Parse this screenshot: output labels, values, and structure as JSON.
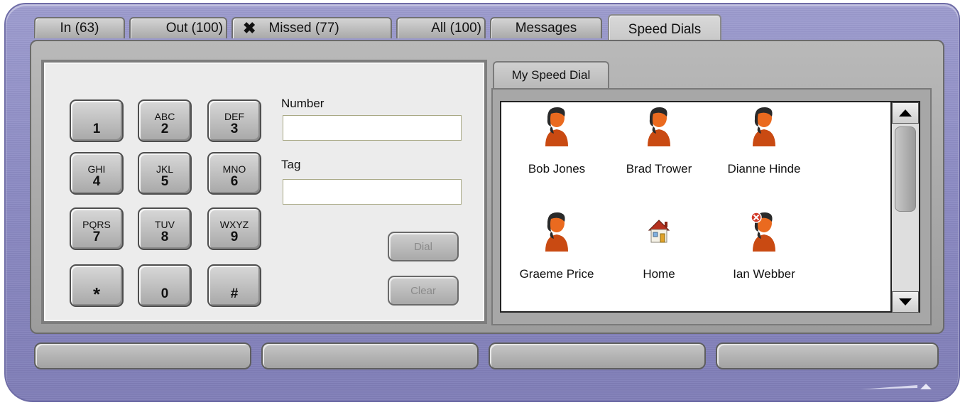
{
  "tabs": [
    {
      "label": "In (63)",
      "active": false
    },
    {
      "label": "Out (100)",
      "active": false
    },
    {
      "label": "Missed (77)",
      "active": false,
      "icon": "x-icon"
    },
    {
      "label": "All (100)",
      "active": false
    },
    {
      "label": "Messages",
      "active": false
    },
    {
      "label": "Speed Dials",
      "active": true
    }
  ],
  "keypad": [
    {
      "sub": "",
      "main": "1"
    },
    {
      "sub": "ABC",
      "main": "2"
    },
    {
      "sub": "DEF",
      "main": "3"
    },
    {
      "sub": "GHI",
      "main": "4"
    },
    {
      "sub": "JKL",
      "main": "5"
    },
    {
      "sub": "MNO",
      "main": "6"
    },
    {
      "sub": "PQRS",
      "main": "7"
    },
    {
      "sub": "TUV",
      "main": "8"
    },
    {
      "sub": "WXYZ",
      "main": "9"
    },
    {
      "sub": "",
      "main": "*"
    },
    {
      "sub": "",
      "main": "0"
    },
    {
      "sub": "",
      "main": "#"
    }
  ],
  "form": {
    "number_label": "Number",
    "number_value": "",
    "tag_label": "Tag",
    "tag_value": "",
    "dial_label": "Dial",
    "clear_label": "Clear"
  },
  "speed_dial": {
    "tab_label": "My Speed Dial",
    "contacts": [
      {
        "name": "Bob Jones",
        "icon": "person-icon"
      },
      {
        "name": "Brad Trower",
        "icon": "person-icon"
      },
      {
        "name": "Dianne Hinde",
        "icon": "person-icon"
      },
      {
        "name": "Graeme Price",
        "icon": "person-icon"
      },
      {
        "name": "Home",
        "icon": "house-icon"
      },
      {
        "name": "Ian Webber",
        "icon": "person-unavailable-icon"
      }
    ]
  },
  "colors": {
    "frame": "#8b8ac3",
    "panel": "#a8a8a8",
    "avatar_body": "#c94a12",
    "avatar_hair": "#2a2a2a"
  }
}
